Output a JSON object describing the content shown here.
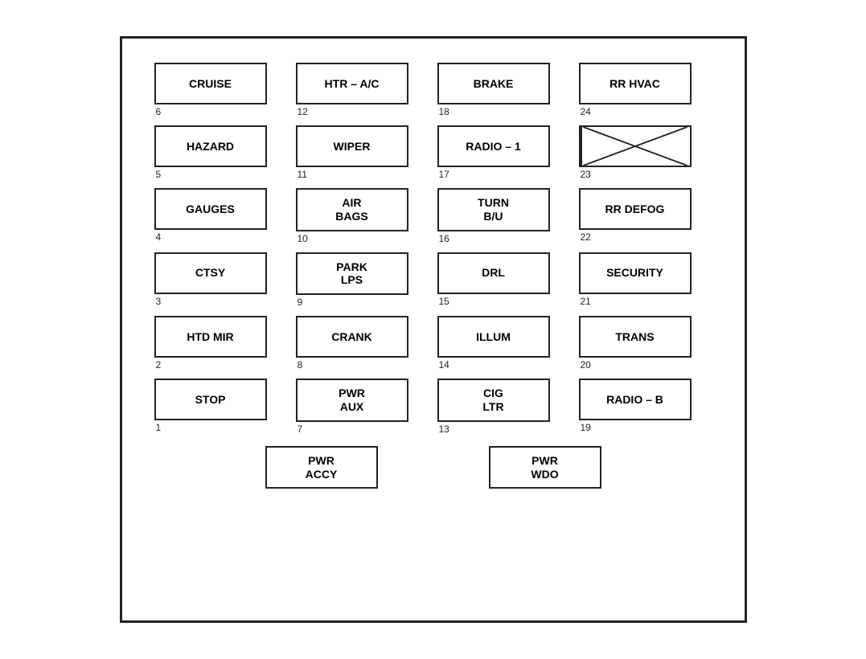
{
  "fuses": [
    [
      {
        "label": "CRUISE",
        "number": "6"
      },
      {
        "label": "HTR – A/C",
        "number": "12"
      },
      {
        "label": "BRAKE",
        "number": "18"
      },
      {
        "label": "RR HVAC",
        "number": "24"
      }
    ],
    [
      {
        "label": "HAZARD",
        "number": "5"
      },
      {
        "label": "WIPER",
        "number": "11"
      },
      {
        "label": "RADIO – 1",
        "number": "17"
      },
      {
        "label": "X",
        "number": "23"
      }
    ],
    [
      {
        "label": "GAUGES",
        "number": "4"
      },
      {
        "label": "AIR\nBAGS",
        "number": "10"
      },
      {
        "label": "TURN\nB/U",
        "number": "16"
      },
      {
        "label": "RR DEFOG",
        "number": "22"
      }
    ],
    [
      {
        "label": "CTSY",
        "number": "3"
      },
      {
        "label": "PARK\nLPS",
        "number": "9"
      },
      {
        "label": "DRL",
        "number": "15"
      },
      {
        "label": "SECURITY",
        "number": "21"
      }
    ],
    [
      {
        "label": "HTD MIR",
        "number": "2"
      },
      {
        "label": "CRANK",
        "number": "8"
      },
      {
        "label": "ILLUM",
        "number": "14"
      },
      {
        "label": "TRANS",
        "number": "20"
      }
    ],
    [
      {
        "label": "STOP",
        "number": "1"
      },
      {
        "label": "PWR\nAUX",
        "number": "7"
      },
      {
        "label": "CIG\nLTR",
        "number": "13"
      },
      {
        "label": "RADIO – B",
        "number": "19"
      }
    ]
  ],
  "bottom": [
    {
      "label": "PWR\nACCY",
      "number": ""
    },
    {
      "label": "PWR\nWDO",
      "number": ""
    }
  ]
}
